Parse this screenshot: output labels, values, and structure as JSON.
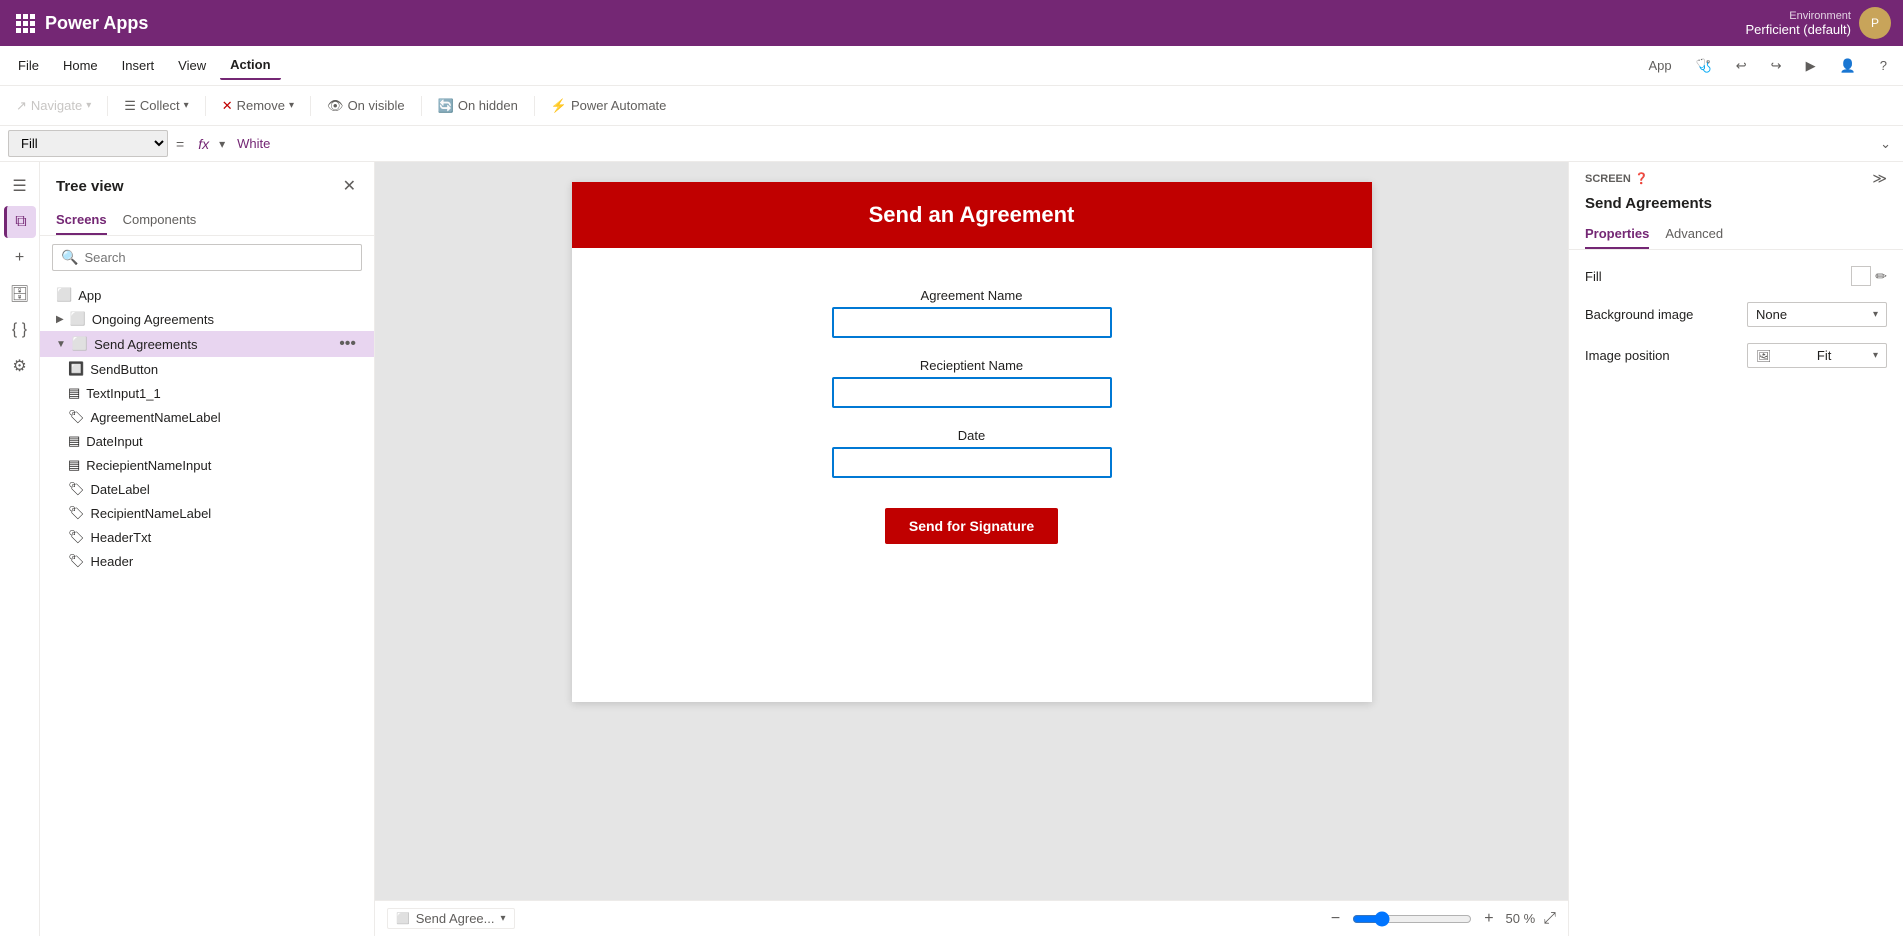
{
  "app": {
    "name": "Power Apps"
  },
  "title_bar": {
    "environment_label": "Environment",
    "environment_name": "Perficient (default)"
  },
  "menu_bar": {
    "items": [
      "File",
      "Home",
      "Insert",
      "View",
      "Action"
    ],
    "active_item": "Action",
    "right_items": [
      "App"
    ],
    "icons": [
      "stethoscope",
      "undo",
      "redo",
      "play",
      "user",
      "help"
    ]
  },
  "toolbar": {
    "navigate_label": "Navigate",
    "collect_label": "Collect",
    "remove_label": "Remove",
    "on_visible_label": "On visible",
    "on_hidden_label": "On hidden",
    "power_automate_label": "Power Automate"
  },
  "formula_bar": {
    "property": "Fill",
    "fx_label": "fx",
    "value": "White"
  },
  "tree_view": {
    "title": "Tree view",
    "tabs": [
      "Screens",
      "Components"
    ],
    "active_tab": "Screens",
    "search_placeholder": "Search",
    "items": [
      {
        "label": "App",
        "type": "app",
        "indent": 0
      },
      {
        "label": "Ongoing Agreements",
        "type": "screen",
        "indent": 0,
        "collapsed": true
      },
      {
        "label": "Send Agreements",
        "type": "screen",
        "indent": 0,
        "collapsed": false,
        "selected": true
      },
      {
        "label": "SendButton",
        "type": "button",
        "indent": 1
      },
      {
        "label": "TextInput1_1",
        "type": "input",
        "indent": 1
      },
      {
        "label": "AgreementNameLabel",
        "type": "label",
        "indent": 1
      },
      {
        "label": "DateInput",
        "type": "input",
        "indent": 1
      },
      {
        "label": "ReciepientNameInput",
        "type": "input",
        "indent": 1
      },
      {
        "label": "DateLabel",
        "type": "label",
        "indent": 1
      },
      {
        "label": "RecipientNameLabel",
        "type": "label",
        "indent": 1
      },
      {
        "label": "HeaderTxt",
        "type": "label",
        "indent": 1
      },
      {
        "label": "Header",
        "type": "label",
        "indent": 1
      }
    ]
  },
  "canvas": {
    "header_text": "Send an Agreement",
    "agreement_name_label": "Agreement Name",
    "recipient_name_label": "Recieptient Name",
    "date_label": "Date",
    "send_button_label": "Send for Signature",
    "screen_name": "Send Agree..."
  },
  "properties_panel": {
    "screen_label": "SCREEN",
    "title": "Send Agreements",
    "tabs": [
      "Properties",
      "Advanced"
    ],
    "active_tab": "Properties",
    "fill_label": "Fill",
    "background_image_label": "Background image",
    "background_image_value": "None",
    "image_position_label": "Image position",
    "image_position_value": "Fit"
  },
  "bottom_bar": {
    "zoom_value": "50",
    "zoom_unit": "%"
  }
}
